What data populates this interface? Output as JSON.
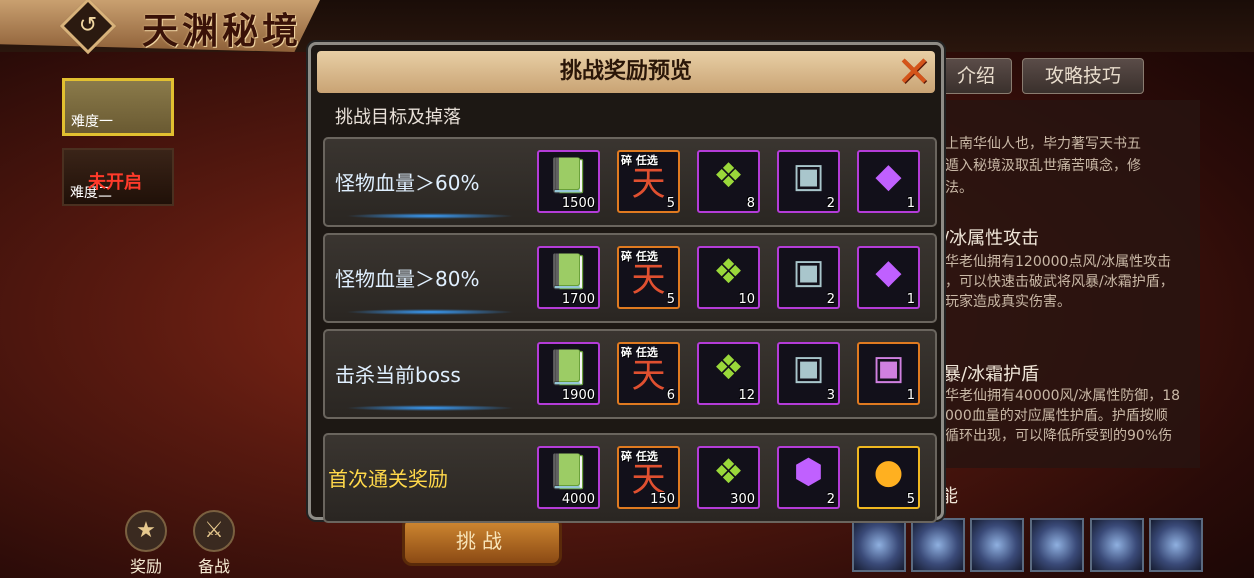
{
  "header": {
    "title": "天渊秘境"
  },
  "sidebar": {
    "difficulties": [
      {
        "label": "难度一"
      },
      {
        "label": "难度二",
        "locked_label": "未开启"
      }
    ]
  },
  "bottom": {
    "reward_label": "奖励",
    "prepare_label": "备战",
    "challenge_label": "挑战"
  },
  "right_panel": {
    "tabs": [
      "介绍",
      "攻略技巧"
    ],
    "intro_lines": [
      "上南华仙人也，毕力著写天书五",
      "遁入秘境汲取乱世痛苦嗔念，修",
      "法。"
    ],
    "section1_title": "/冰属性攻击",
    "section1_lines": [
      "华老仙拥有120000点风/冰属性攻击",
      "，可以快速击破武将风暴/冰霜护盾，",
      "玩家造成真实伤害。"
    ],
    "section2_title": "暴/冰霜护盾",
    "section2_lines": [
      "华老仙拥有40000风/冰属性防御，18",
      "000血量的对应属性护盾。护盾按顺",
      "循环出现，可以降低所受到的90%伤"
    ],
    "partial_heading": "能"
  },
  "modal": {
    "title": "挑战奖励预览",
    "subtitle": "挑战目标及掉落",
    "item_tag_left": "碎",
    "item_tag_right": "任选",
    "rows": [
      {
        "label": "怪物血量＞60%",
        "items": [
          {
            "icon": "green-book",
            "qty": "1500",
            "frame": "purple"
          },
          {
            "icon": "red-chest",
            "qty": "5",
            "frame": "orange"
          },
          {
            "icon": "green-cube",
            "qty": "8",
            "frame": "purple"
          },
          {
            "icon": "silver-chest",
            "qty": "2",
            "frame": "purple"
          },
          {
            "icon": "purple-gem",
            "qty": "1",
            "frame": "purple"
          }
        ]
      },
      {
        "label": "怪物血量＞80%",
        "items": [
          {
            "icon": "green-book",
            "qty": "1700",
            "frame": "purple"
          },
          {
            "icon": "red-chest",
            "qty": "5",
            "frame": "orange"
          },
          {
            "icon": "green-cube",
            "qty": "10",
            "frame": "purple"
          },
          {
            "icon": "silver-chest",
            "qty": "2",
            "frame": "purple"
          },
          {
            "icon": "purple-gem",
            "qty": "1",
            "frame": "purple"
          }
        ]
      },
      {
        "label": "击杀当前boss",
        "items": [
          {
            "icon": "green-book",
            "qty": "1900",
            "frame": "purple"
          },
          {
            "icon": "red-chest",
            "qty": "6",
            "frame": "orange"
          },
          {
            "icon": "green-cube",
            "qty": "12",
            "frame": "purple"
          },
          {
            "icon": "silver-chest",
            "qty": "3",
            "frame": "purple"
          },
          {
            "icon": "purple-chest",
            "qty": "1",
            "frame": "orange"
          }
        ]
      },
      {
        "label": "首次通关奖励",
        "items": [
          {
            "icon": "green-book",
            "qty": "4000",
            "frame": "purple"
          },
          {
            "icon": "red-chest",
            "qty": "150",
            "frame": "orange"
          },
          {
            "icon": "green-cube",
            "qty": "300",
            "frame": "purple"
          },
          {
            "icon": "purple-crystal",
            "qty": "2",
            "frame": "purple"
          },
          {
            "icon": "gold-gem",
            "qty": "5",
            "frame": "gold"
          }
        ]
      }
    ]
  }
}
